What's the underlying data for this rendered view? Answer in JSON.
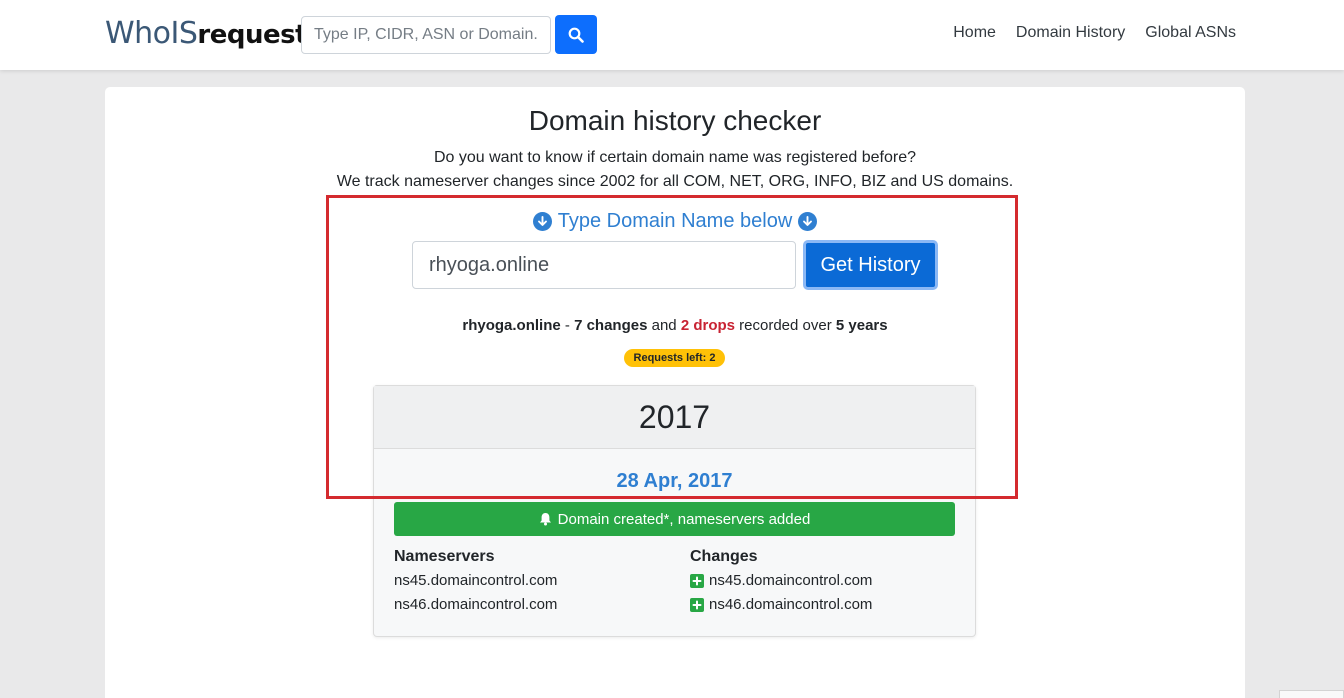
{
  "nav": {
    "logo_who": "WhoIS",
    "logo_request": "request",
    "search_placeholder": "Type IP, CIDR, ASN or Domain..",
    "links": [
      "Home",
      "Domain History",
      "Global ASNs"
    ]
  },
  "main": {
    "title": "Domain history checker",
    "subtitle_line1": "Do you want to know if certain domain name was registered before?",
    "subtitle_line2": "We track nameserver changes since 2002 for all COM, NET, ORG, INFO, BIZ and US domains.",
    "type_label": "Type Domain Name below",
    "domain_value": "rhyoga.online",
    "get_button": "Get History",
    "summary": {
      "domain": "rhyoga.online",
      "sep": " - ",
      "changes": "7 changes",
      "and": " and ",
      "drops": "2 drops",
      "recorded": " recorded over ",
      "years": "5 years"
    },
    "requests_badge": "Requests left: 2"
  },
  "history": {
    "year": "2017",
    "date": "28 Apr, 2017",
    "event": "Domain created*, nameservers added",
    "nameservers_header": "Nameservers",
    "changes_header": "Changes",
    "nameservers": [
      "ns45.domaincontrol.com",
      "ns46.domaincontrol.com"
    ],
    "changes": [
      "ns45.domaincontrol.com",
      "ns46.domaincontrol.com"
    ]
  },
  "colors": {
    "primary": "#0d6efd",
    "accent_blue": "#2f7fd1",
    "success": "#28a745",
    "danger": "#c82333",
    "warning": "#ffc107",
    "highlight": "#d42a2f"
  }
}
